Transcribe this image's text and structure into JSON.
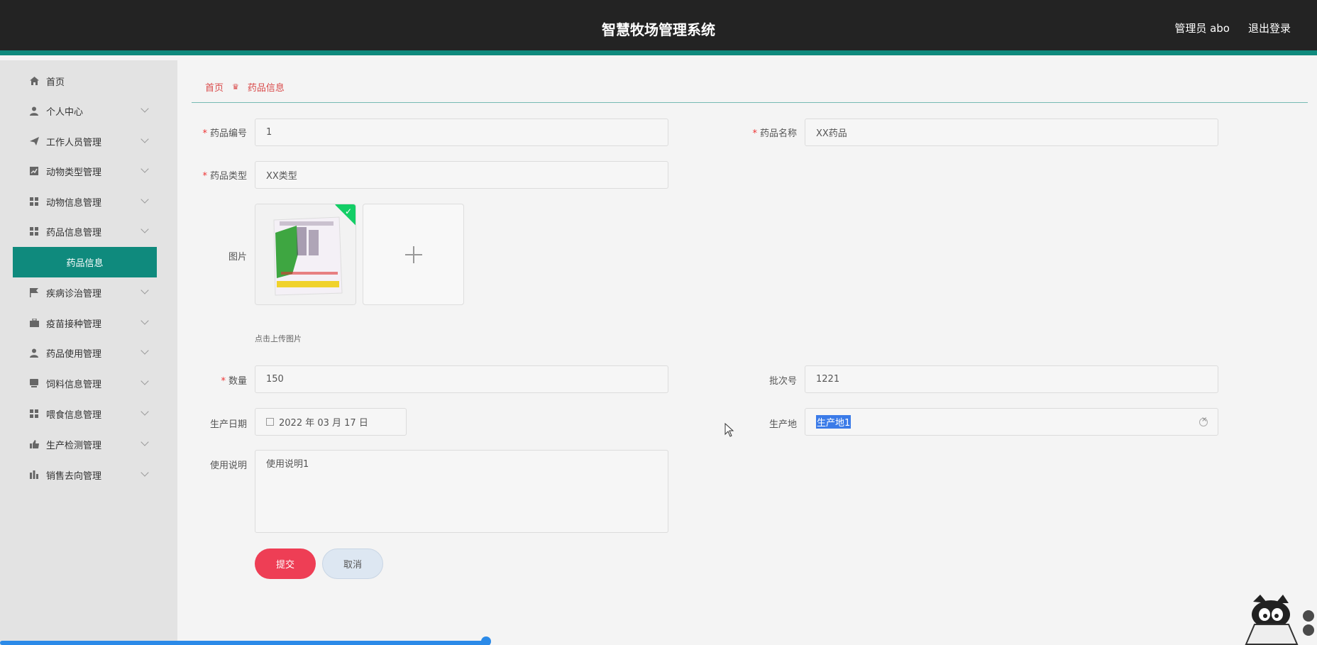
{
  "header": {
    "title": "智慧牧场管理系统",
    "admin": "管理员 abo",
    "logout": "退出登录"
  },
  "sidebar": {
    "items": [
      {
        "label": "首页",
        "icon": "home-icon",
        "has_children": false
      },
      {
        "label": "个人中心",
        "icon": "user-icon",
        "has_children": true
      },
      {
        "label": "工作人员管理",
        "icon": "send-icon",
        "has_children": true
      },
      {
        "label": "动物类型管理",
        "icon": "chart-icon",
        "has_children": true
      },
      {
        "label": "动物信息管理",
        "icon": "grid-icon",
        "has_children": true
      },
      {
        "label": "药品信息管理",
        "icon": "grid-icon",
        "has_children": true
      },
      {
        "label": "疾病诊治管理",
        "icon": "flag-icon",
        "has_children": true
      },
      {
        "label": "疫苗接种管理",
        "icon": "briefcase-icon",
        "has_children": true
      },
      {
        "label": "药品使用管理",
        "icon": "user-icon",
        "has_children": true
      },
      {
        "label": "饲料信息管理",
        "icon": "box-icon",
        "has_children": true
      },
      {
        "label": "喂食信息管理",
        "icon": "grid-icon",
        "has_children": true
      },
      {
        "label": "生产检测管理",
        "icon": "thumb-icon",
        "has_children": true
      },
      {
        "label": "销售去向管理",
        "icon": "bar-icon",
        "has_children": true
      }
    ],
    "active_sub": "药品信息"
  },
  "breadcrumb": {
    "home": "首页",
    "current": "药品信息"
  },
  "form": {
    "code_label": "药品编号",
    "code_value": "1",
    "name_label": "药品名称",
    "name_value": "XX药品",
    "type_label": "药品类型",
    "type_value": "XX类型",
    "image_label": "图片",
    "upload_hint": "点击上传图片",
    "qty_label": "数量",
    "qty_value": "150",
    "batch_label": "批次号",
    "batch_value": "1221",
    "date_label": "生产日期",
    "date_value": "2022 年 03 月 17 日",
    "origin_label": "生产地",
    "origin_value": "生产地1",
    "usage_label": "使用说明",
    "usage_value": "使用说明1",
    "submit": "提交",
    "cancel": "取消"
  },
  "colors": {
    "accent": "#0f8a7d",
    "header_bg": "#232323",
    "submit": "#ee3e55",
    "required": "#e33333"
  }
}
